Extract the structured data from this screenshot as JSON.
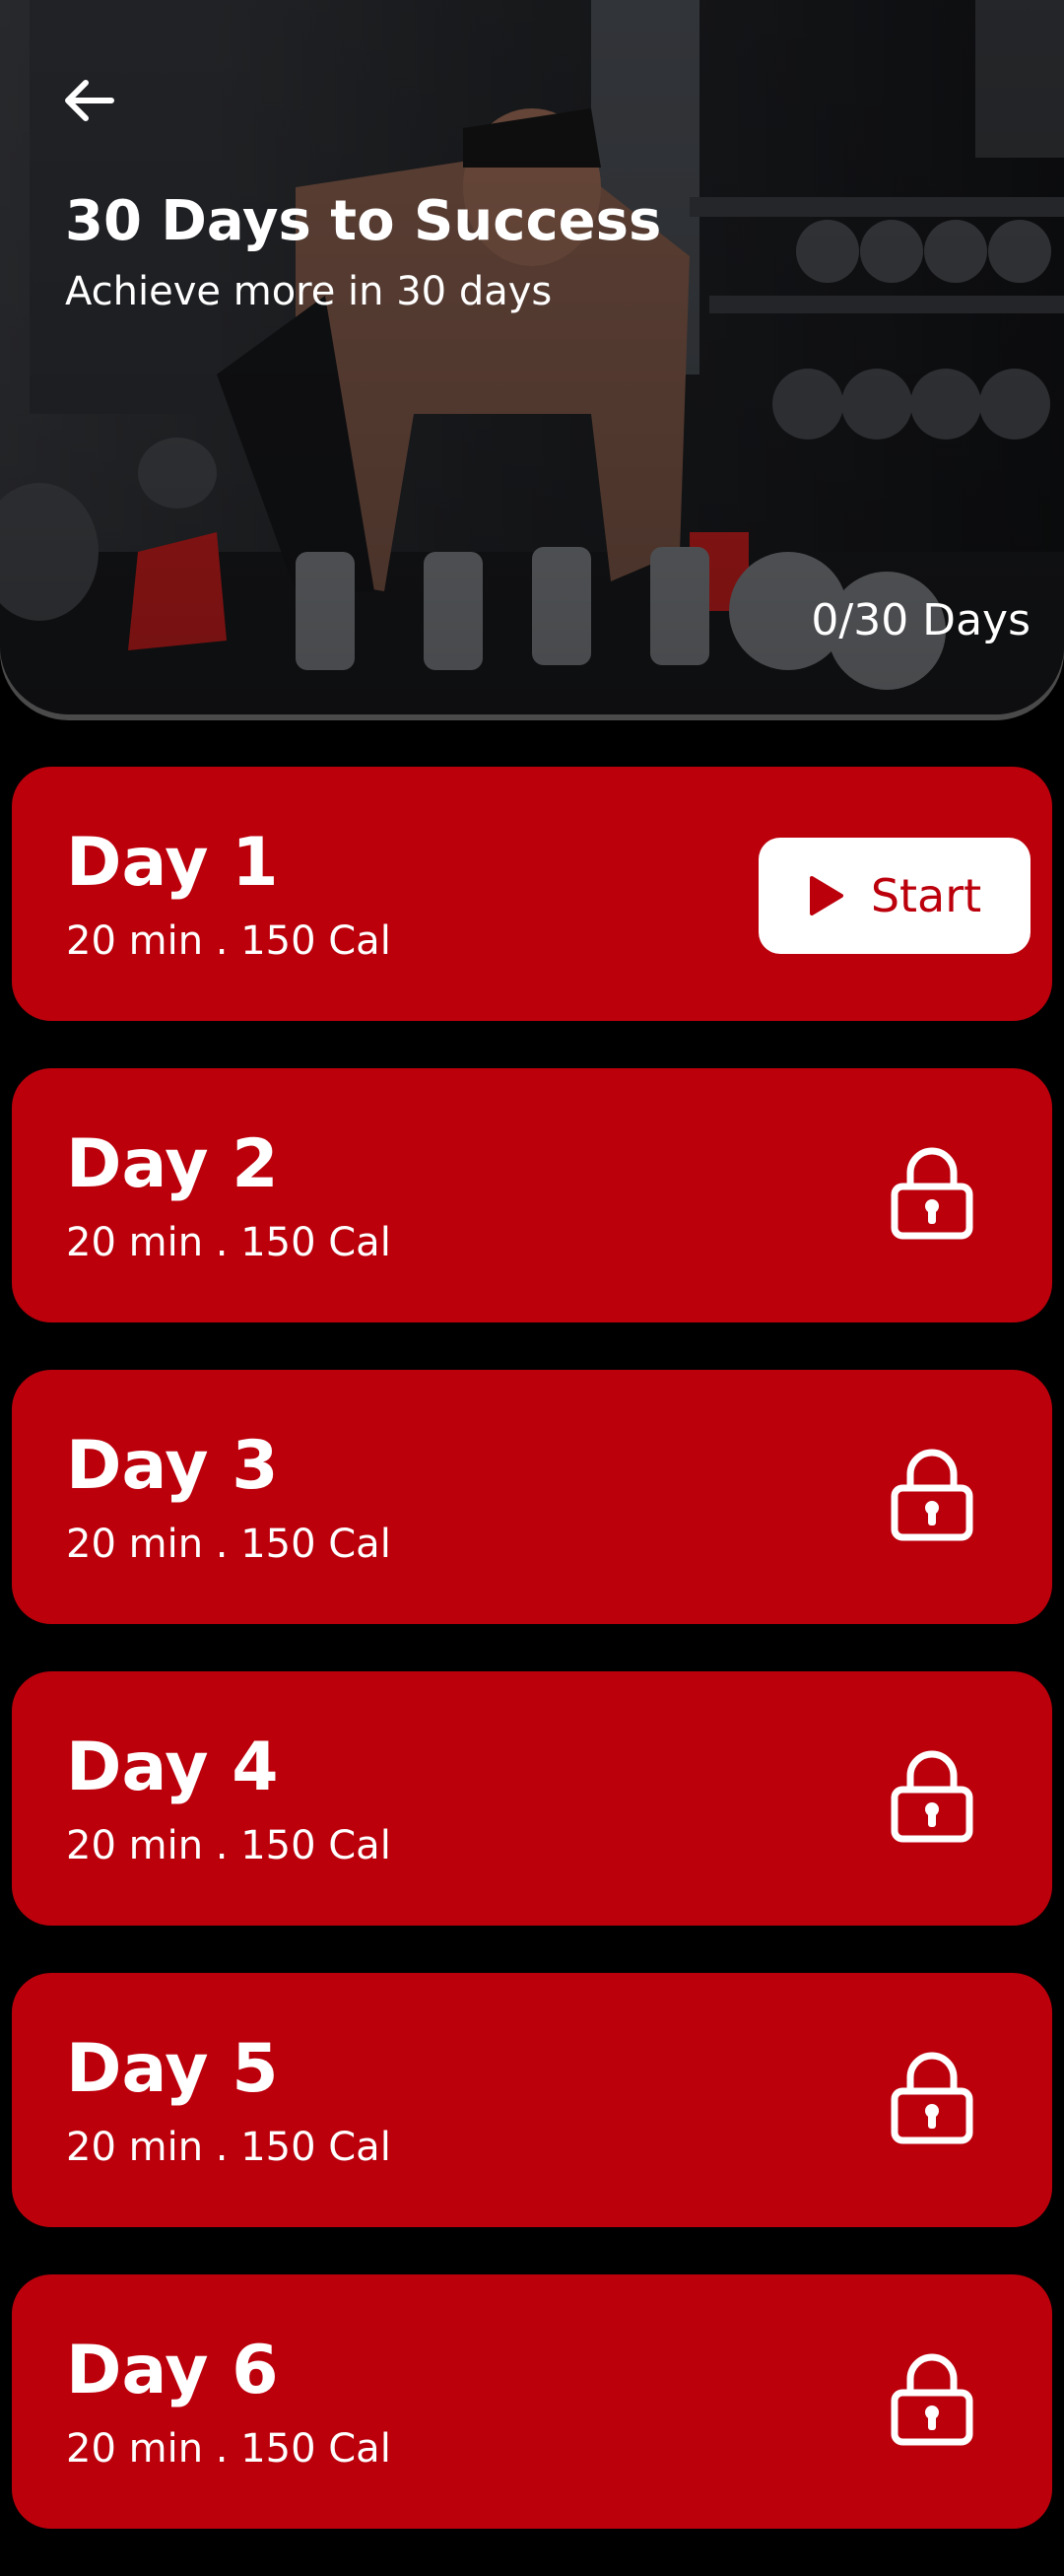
{
  "header": {
    "title": "30 Days to Success",
    "subtitle": "Achieve more in 30 days",
    "progress": "0/30 Days",
    "back_icon": "arrow-left-icon"
  },
  "days": [
    {
      "title": "Day 1",
      "meta": "20 min . 150 Cal",
      "state": "start",
      "action_label": "Start",
      "action_icon": "play-icon"
    },
    {
      "title": "Day 2",
      "meta": "20 min . 150 Cal",
      "state": "locked",
      "action_icon": "lock-icon"
    },
    {
      "title": "Day 3",
      "meta": "20 min . 150 Cal",
      "state": "locked",
      "action_icon": "lock-icon"
    },
    {
      "title": "Day 4",
      "meta": "20 min . 150 Cal",
      "state": "locked",
      "action_icon": "lock-icon"
    },
    {
      "title": "Day 5",
      "meta": "20 min . 150 Cal",
      "state": "locked",
      "action_icon": "lock-icon"
    },
    {
      "title": "Day 6",
      "meta": "20 min . 150 Cal",
      "state": "locked",
      "action_icon": "lock-icon"
    }
  ],
  "colors": {
    "background": "#000000",
    "card": "#bb000c",
    "text": "#ffffff",
    "button_bg": "#ffffff",
    "button_text": "#bb000c"
  }
}
